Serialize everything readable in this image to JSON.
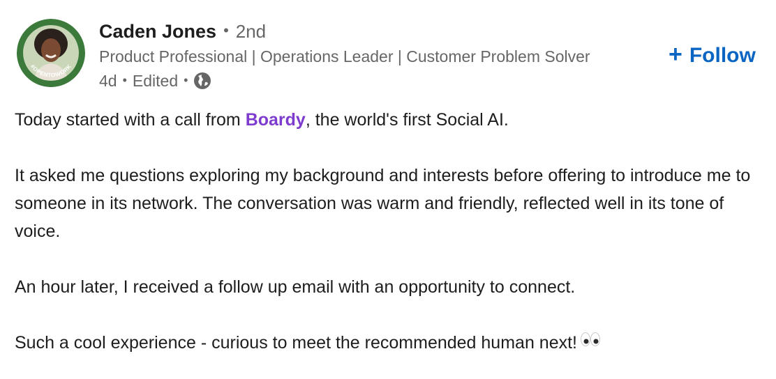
{
  "author": {
    "name": "Caden Jones",
    "degree": "2nd",
    "headline": "Product Professional | Operations Leader | Customer Problem Solver",
    "avatar_badge_text": "#OPENTOWORK"
  },
  "meta": {
    "age": "4d",
    "edited": "Edited",
    "visibility_icon": "globe-icon"
  },
  "follow": {
    "icon": "plus-icon",
    "label": "Follow"
  },
  "post": {
    "line1_before": "Today started with a call from ",
    "mention": "Boardy",
    "line1_after": ", the world's first Social AI.",
    "para2": "It asked me questions exploring my background and interests before offering to introduce me to someone in its network. The conversation was warm and friendly, reflected well in its tone of voice.",
    "para3": "An hour later, I received a follow up email with an opportunity to connect.",
    "para4": "Such a cool experience - curious to meet the recommended human next!",
    "emoji": "eyes-emoji"
  },
  "colors": {
    "follow_blue": "#0a66c2",
    "mention_purple": "#7e3ccf",
    "opentowork_green": "#3b7a3b",
    "secondary_text": "#666666"
  }
}
